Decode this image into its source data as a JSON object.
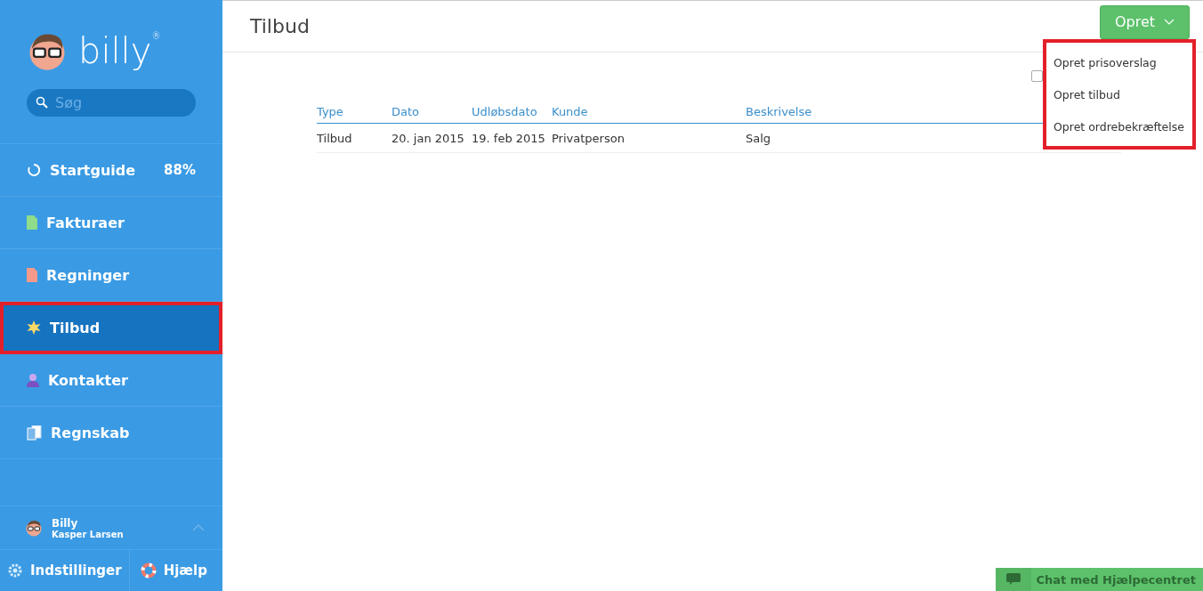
{
  "logo": {
    "text": "billy",
    "mark": "®"
  },
  "search": {
    "placeholder": "Søg"
  },
  "nav": [
    {
      "label": "Startguide",
      "kind": "progress",
      "badge": "88%",
      "selected": false
    },
    {
      "label": "Fakturaer",
      "kind": "invoice",
      "selected": false
    },
    {
      "label": "Regninger",
      "kind": "bill",
      "selected": false
    },
    {
      "label": "Tilbud",
      "kind": "quote",
      "selected": true
    },
    {
      "label": "Kontakter",
      "kind": "contact",
      "selected": false
    },
    {
      "label": "Regnskab",
      "kind": "ledger",
      "selected": false
    }
  ],
  "user": {
    "company": "Billy",
    "name": "Kasper Larsen"
  },
  "footer": [
    {
      "label": "Indstillinger",
      "kind": "settings"
    },
    {
      "label": "Hjælp",
      "kind": "help"
    }
  ],
  "page": {
    "title": "Tilbud"
  },
  "create_button": {
    "label": "Opret"
  },
  "dropdown": [
    "Opret prisoverslag",
    "Opret tilbud",
    "Opret ordrebekræftelse"
  ],
  "filter_checkbox": {
    "checked": false
  },
  "table": {
    "columns": [
      "Type",
      "Dato",
      "Udløbsdato",
      "Kunde",
      "Beskrivelse"
    ],
    "rows": [
      [
        "Tilbud",
        "20. jan 2015",
        "19. feb 2015",
        "Privatperson",
        "Salg"
      ]
    ]
  },
  "chat": {
    "label": "Chat med Hjælpecentret"
  }
}
